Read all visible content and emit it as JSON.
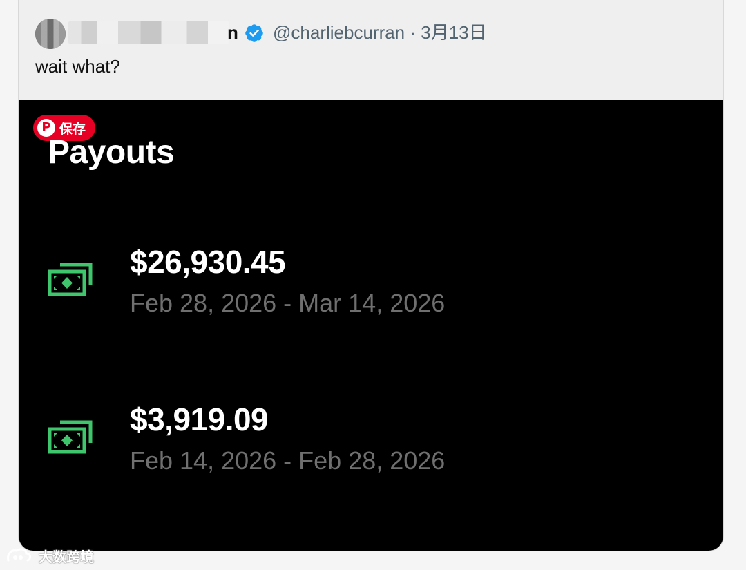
{
  "tweet": {
    "name_visible_tail": "n",
    "handle": "@charliebcurran",
    "separator": "·",
    "date": "3月13日",
    "text": "wait what?"
  },
  "pinterest": {
    "save_label": "保存"
  },
  "screenshot": {
    "title": "Payouts",
    "payouts": [
      {
        "amount": "$26,930.45",
        "period": "Feb 28, 2026 - Mar 14, 2026",
        "icon": "cash-icon"
      },
      {
        "amount": "$3,919.09",
        "period": "Feb 14, 2026 - Feb 28, 2026",
        "icon": "cash-icon"
      }
    ]
  },
  "watermark": {
    "text": "大数跨境"
  },
  "colors": {
    "cash_green": "#3fc56b",
    "verified_blue": "#1d9bf0",
    "pinterest_red": "#e60023",
    "secondary_text": "#536471"
  }
}
